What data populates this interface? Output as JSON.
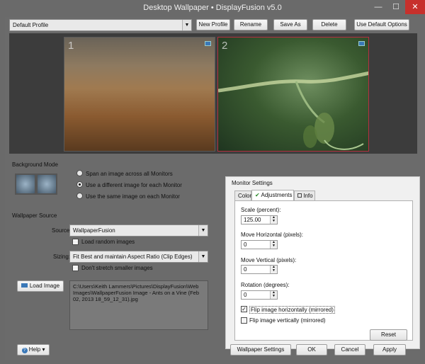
{
  "window": {
    "title": "Desktop Wallpaper • DisplayFusion v5.0",
    "minimize_glyph": "—",
    "maximize_glyph": "☐",
    "close_glyph": "✕"
  },
  "profile_bar": {
    "profile_value": "Default Profile",
    "new_profile": "New Profile",
    "rename": "Rename",
    "save_as": "Save As",
    "delete": "Delete",
    "use_default_options": "Use Default Options"
  },
  "preview": {
    "monitor1_number": "1",
    "monitor2_number": "2"
  },
  "background_mode": {
    "label": "Background Mode",
    "options": [
      "Span an image across all Monitors",
      "Use a different image for each Monitor",
      "Use the same image on each Monitor"
    ],
    "selected_index": 1
  },
  "wallpaper_source": {
    "label": "Wallpaper Source",
    "source_label": "Source:",
    "source_value": "WallpaperFusion",
    "load_random": "Load random images",
    "sizing_label": "Sizing:",
    "sizing_value": "Fit Best and maintain Aspect Ratio (Clip Edges)",
    "dont_stretch": "Don't stretch smaller images",
    "load_image": "Load Image",
    "path_text": "C:\\Users\\Keith Lammers\\Pictures\\DisplayFusion\\Web Images\\WallpaperFusion Image - Ants on a Vine (Feb 02, 2013 18_59_12_31).jpg"
  },
  "monitor_settings": {
    "title": "Monitor Settings",
    "tabs": [
      "Color",
      "Adjustments",
      "Info"
    ],
    "active_tab": "Adjustments",
    "scale_label": "Scale (percent):",
    "scale_value": "125.00",
    "move_h_label": "Move Horizontal (pixels):",
    "move_h_value": "0",
    "move_v_label": "Move Vertical (pixels):",
    "move_v_value": "0",
    "rotation_label": "Rotation (degrees):",
    "rotation_value": "0",
    "flip_h_label": "Flip image horizontally (mirrored)",
    "flip_h_checked": true,
    "flip_v_label": "Flip image vertically (mirrored)",
    "flip_v_checked": false,
    "reset": "Reset"
  },
  "bottom": {
    "help": "Help",
    "wallpaper_settings": "Wallpaper Settings",
    "ok": "OK",
    "cancel": "Cancel",
    "apply": "Apply"
  },
  "colors": {
    "close_button": "#c7302c",
    "selected_monitor_border": "#b53040",
    "popup_background": "#f0f0f0"
  }
}
